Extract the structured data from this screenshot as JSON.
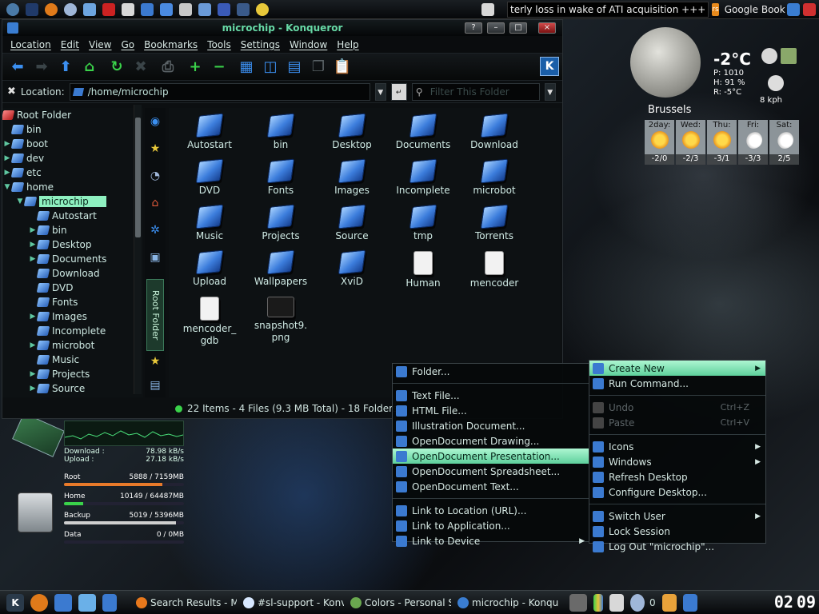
{
  "top_panel": {
    "ticker_text": "terly loss in wake of ATI acquisition +++",
    "ticker_book": "Google Book"
  },
  "window": {
    "title": "microchip - Konqueror",
    "menu": [
      "Location",
      "Edit",
      "View",
      "Go",
      "Bookmarks",
      "Tools",
      "Settings",
      "Window",
      "Help"
    ],
    "location_label": "Location:",
    "location_value": "/home/microchip",
    "filter_placeholder": "Filter This Folder"
  },
  "tree": {
    "root": "Root Folder",
    "items": [
      {
        "label": "bin",
        "depth": 0,
        "expandable": false
      },
      {
        "label": "boot",
        "depth": 0,
        "expandable": true
      },
      {
        "label": "dev",
        "depth": 0,
        "expandable": true
      },
      {
        "label": "etc",
        "depth": 0,
        "expandable": true
      },
      {
        "label": "home",
        "depth": 0,
        "expandable": true,
        "expanded": true
      },
      {
        "label": "microchip",
        "depth": 1,
        "expandable": true,
        "expanded": true,
        "selected": true
      },
      {
        "label": "Autostart",
        "depth": 2,
        "expandable": false
      },
      {
        "label": "bin",
        "depth": 2,
        "expandable": true
      },
      {
        "label": "Desktop",
        "depth": 2,
        "expandable": true
      },
      {
        "label": "Documents",
        "depth": 2,
        "expandable": true
      },
      {
        "label": "Download",
        "depth": 2,
        "expandable": false
      },
      {
        "label": "DVD",
        "depth": 2,
        "expandable": false
      },
      {
        "label": "Fonts",
        "depth": 2,
        "expandable": false
      },
      {
        "label": "Images",
        "depth": 2,
        "expandable": true
      },
      {
        "label": "Incomplete",
        "depth": 2,
        "expandable": false
      },
      {
        "label": "microbot",
        "depth": 2,
        "expandable": true
      },
      {
        "label": "Music",
        "depth": 2,
        "expandable": false
      },
      {
        "label": "Projects",
        "depth": 2,
        "expandable": true
      },
      {
        "label": "Source",
        "depth": 2,
        "expandable": true
      }
    ]
  },
  "sidebar": {
    "active_tab": "Root Folder"
  },
  "files": [
    {
      "name": "Autostart",
      "kind": "folder"
    },
    {
      "name": "bin",
      "kind": "folder"
    },
    {
      "name": "Desktop",
      "kind": "folder"
    },
    {
      "name": "Documents",
      "kind": "folder"
    },
    {
      "name": "Download",
      "kind": "folder"
    },
    {
      "name": "DVD",
      "kind": "folder"
    },
    {
      "name": "Fonts",
      "kind": "folder"
    },
    {
      "name": "Images",
      "kind": "folder"
    },
    {
      "name": "Incomplete",
      "kind": "folder"
    },
    {
      "name": "microbot",
      "kind": "folder"
    },
    {
      "name": "Music",
      "kind": "folder"
    },
    {
      "name": "Projects",
      "kind": "folder"
    },
    {
      "name": "Source",
      "kind": "folder"
    },
    {
      "name": "tmp",
      "kind": "folder"
    },
    {
      "name": "Torrents",
      "kind": "folder"
    },
    {
      "name": "Upload",
      "kind": "folder"
    },
    {
      "name": "Wallpapers",
      "kind": "folder"
    },
    {
      "name": "XviD",
      "kind": "folder"
    },
    {
      "name": "Human",
      "kind": "doc"
    },
    {
      "name": "mencoder",
      "kind": "doc"
    },
    {
      "name": "mencoder_\ngdb",
      "kind": "doc"
    },
    {
      "name": "snapshot9.\npng",
      "kind": "image"
    }
  ],
  "status": "22 Items - 4 Files (9.3 MB Total) - 18 Folders",
  "weather": {
    "temperature": "-2°C",
    "details": [
      "P: 1010",
      "H: 91 %",
      "R: -5°C"
    ],
    "wind": "8 kph",
    "city": "Brussels",
    "forecast": [
      {
        "day": "2day:",
        "range": "-2/0",
        "icon": "sun-cloud"
      },
      {
        "day": "Wed:",
        "range": "-2/3",
        "icon": "sun"
      },
      {
        "day": "Thu:",
        "range": "-3/1",
        "icon": "sun-cloud"
      },
      {
        "day": "Fri:",
        "range": "-3/3",
        "icon": "snow"
      },
      {
        "day": "Sat:",
        "range": "2/5",
        "icon": "cloud"
      }
    ]
  },
  "sysmon": {
    "download": {
      "label": "Download :",
      "value": "78.98 kB/s"
    },
    "upload": {
      "label": "Upload :",
      "value": "27.18 kB/s"
    },
    "disks": [
      {
        "name": "Root",
        "usage": "5888 / 7159MB",
        "fill_fraction": 0.82,
        "color": "#e87a2a"
      },
      {
        "name": "Home",
        "usage": "10149 / 64487MB",
        "fill_fraction": 0.16,
        "color": "#3ad24a"
      },
      {
        "name": "Backup",
        "usage": "5019 / 5396MB",
        "fill_fraction": 0.93,
        "color": "#cfcfcf"
      },
      {
        "name": "Data",
        "usage": "0 / 0MB",
        "fill_fraction": 0,
        "color": "#cfcfcf"
      }
    ]
  },
  "desktop_menu": {
    "items": [
      {
        "label": "Create New",
        "icon": "new-icon",
        "submenu": true,
        "highlighted": true
      },
      {
        "label": "Run Command...",
        "icon": "gear-icon"
      },
      {
        "sep": true
      },
      {
        "label": "Undo",
        "icon": "undo-icon",
        "shortcut": "Ctrl+Z",
        "disabled": true
      },
      {
        "label": "Paste",
        "icon": "paste-icon",
        "shortcut": "Ctrl+V",
        "disabled": true
      },
      {
        "sep": true
      },
      {
        "label": "Icons",
        "icon": "icons-icon",
        "submenu": true
      },
      {
        "label": "Windows",
        "icon": "windows-icon",
        "submenu": true
      },
      {
        "label": "Refresh Desktop",
        "icon": "refresh-icon"
      },
      {
        "label": "Configure Desktop...",
        "icon": "configure-icon"
      },
      {
        "sep": true
      },
      {
        "label": "Switch User",
        "icon": "switch-user-icon",
        "submenu": true
      },
      {
        "label": "Lock Session",
        "icon": "lock-icon"
      },
      {
        "label": "Log Out \"microchip\"...",
        "icon": "logout-icon"
      }
    ]
  },
  "create_new_menu": {
    "items": [
      {
        "label": "Folder...",
        "icon": "folder-icon"
      },
      {
        "sep": true
      },
      {
        "label": "Text File...",
        "icon": "text-file-icon"
      },
      {
        "label": "HTML File...",
        "icon": "html-file-icon"
      },
      {
        "label": "Illustration Document...",
        "icon": "illustration-icon"
      },
      {
        "label": "OpenDocument Drawing...",
        "icon": "drawing-icon"
      },
      {
        "label": "OpenDocument Presentation...",
        "icon": "presentation-icon",
        "highlighted": true
      },
      {
        "label": "OpenDocument Spreadsheet...",
        "icon": "spreadsheet-icon"
      },
      {
        "label": "OpenDocument Text...",
        "icon": "odt-icon"
      },
      {
        "sep": true
      },
      {
        "label": "Link to Location (URL)...",
        "icon": "link-url-icon"
      },
      {
        "label": "Link to Application...",
        "icon": "link-app-icon"
      },
      {
        "label": "Link to Device",
        "icon": "link-device-icon",
        "submenu": true
      }
    ]
  },
  "taskbar": {
    "tasks": [
      {
        "label": "Search Results - Mozil",
        "color": "#e8781c"
      },
      {
        "label": "#sl-support - Konvers",
        "color": "#d8e8ff"
      },
      {
        "label": "Colors - Personal Sett",
        "color": "#6aa84f"
      },
      {
        "label": "microchip - Konqueror",
        "color": "#3a7dd1"
      }
    ],
    "tray_number": "0",
    "clock": [
      "02",
      "09"
    ]
  }
}
